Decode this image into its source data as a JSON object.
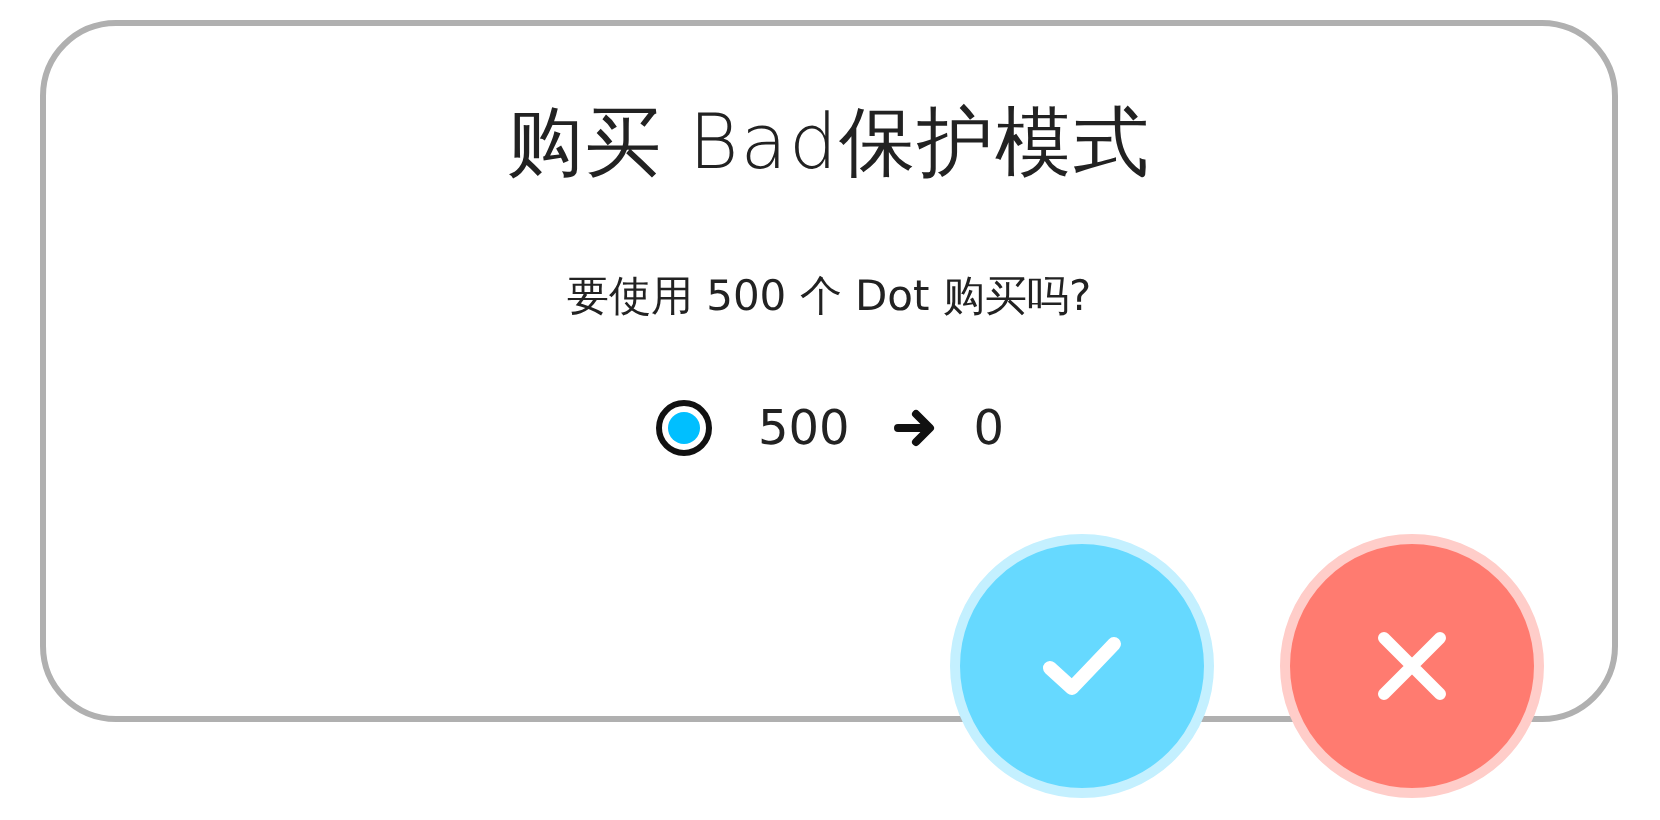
{
  "dialog": {
    "title": "购买 Bad保护模式",
    "question": "要使用 500 个 Dot 购买吗?",
    "balance": {
      "before": "500",
      "after": "0"
    },
    "buttons": [
      {
        "kind": "confirm"
      },
      {
        "kind": "cancel"
      }
    ]
  }
}
